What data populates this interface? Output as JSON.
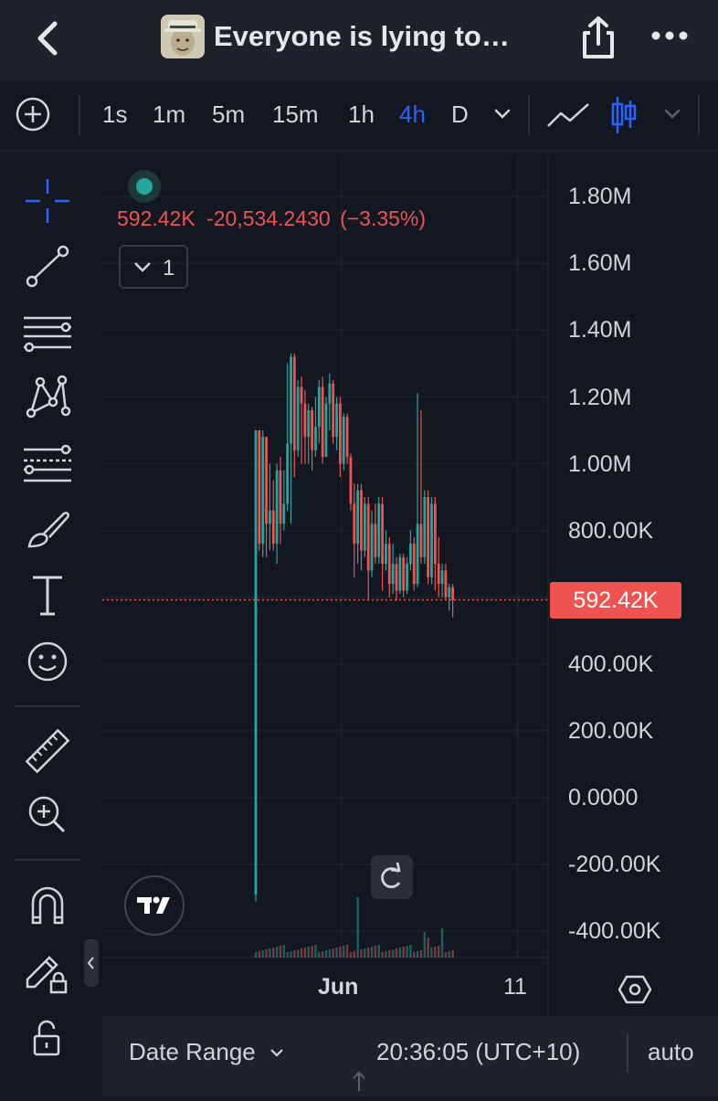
{
  "header": {
    "title": "Everyone is lying to…",
    "back_icon": "chevron-left-icon",
    "share_icon": "share-icon",
    "more_icon": "more-horizontal-icon"
  },
  "toolbar": {
    "intervals": [
      "1s",
      "1m",
      "5m",
      "15m",
      "1h",
      "4h",
      "D"
    ],
    "active_interval": "4h"
  },
  "left_tools": [
    "crosshair-icon",
    "trend-line-icon",
    "horizontal-lines-icon",
    "pattern-icon",
    "fib-icon",
    "brush-icon",
    "text-icon",
    "emoji-icon",
    "ruler-icon",
    "zoom-in-icon",
    "magnet-icon",
    "lock-pencil-icon",
    "unlock-icon"
  ],
  "legend": {
    "price": "592.42K",
    "change": "-20,534.2430",
    "change_pct": "(−3.35%)",
    "collapse_count": "1"
  },
  "y_axis": {
    "labels": [
      "1.80M",
      "1.60M",
      "1.40M",
      "1.20M",
      "1.00M",
      "800.00K",
      "592.42K",
      "400.00K",
      "200.00K",
      "0.0000",
      "-200.00K",
      "-400.00K"
    ],
    "current_price": "592.42K"
  },
  "x_axis": {
    "labels": [
      "Jun",
      "11"
    ]
  },
  "colors": {
    "background": "#131722",
    "up": "#26a69a",
    "down": "#ef5350",
    "accent": "#2962ff"
  },
  "chart_data": {
    "type": "candlestick",
    "x_ticks": [
      "Jun",
      "11"
    ],
    "ylim": [
      -450000,
      1900000
    ],
    "last_price": 592420,
    "change": -20534.243,
    "change_pct": -3.35,
    "candles": [
      [
        -290000,
        1100000,
        -310000,
        1100000
      ],
      [
        1100000,
        760000,
        740000,
        1100000
      ],
      [
        760000,
        1080000,
        720000,
        1100000
      ],
      [
        1080000,
        820000,
        720000,
        1080000
      ],
      [
        820000,
        860000,
        740000,
        1000000
      ],
      [
        860000,
        760000,
        740000,
        950000
      ],
      [
        760000,
        980000,
        700000,
        1000000
      ],
      [
        980000,
        820000,
        760000,
        1020000
      ],
      [
        820000,
        880000,
        800000,
        980000
      ],
      [
        880000,
        1060000,
        860000,
        1300000
      ],
      [
        1060000,
        1320000,
        820000,
        1330000
      ],
      [
        1320000,
        1040000,
        960000,
        1330000
      ],
      [
        1040000,
        1230000,
        1020000,
        1250000
      ],
      [
        1230000,
        1180000,
        1000000,
        1260000
      ],
      [
        1180000,
        1080000,
        1000000,
        1220000
      ],
      [
        1080000,
        1160000,
        1000000,
        1180000
      ],
      [
        1160000,
        1040000,
        980000,
        1170000
      ],
      [
        1040000,
        1110000,
        1020000,
        1200000
      ],
      [
        1110000,
        1230000,
        1060000,
        1250000
      ],
      [
        1230000,
        1020000,
        1000000,
        1260000
      ],
      [
        1020000,
        1180000,
        1020000,
        1200000
      ],
      [
        1180000,
        1240000,
        1100000,
        1270000
      ],
      [
        1240000,
        1080000,
        1060000,
        1250000
      ],
      [
        1080000,
        1180000,
        1040000,
        1200000
      ],
      [
        1180000,
        1000000,
        960000,
        1200000
      ],
      [
        1000000,
        1140000,
        980000,
        1150000
      ],
      [
        1140000,
        1020000,
        1000000,
        1150000
      ],
      [
        1020000,
        880000,
        860000,
        1030000
      ],
      [
        880000,
        760000,
        660000,
        940000
      ],
      [
        760000,
        920000,
        700000,
        940000
      ],
      [
        920000,
        740000,
        680000,
        940000
      ],
      [
        740000,
        880000,
        720000,
        900000
      ],
      [
        880000,
        680000,
        590000,
        900000
      ],
      [
        680000,
        820000,
        660000,
        860000
      ],
      [
        820000,
        720000,
        700000,
        880000
      ],
      [
        720000,
        880000,
        700000,
        900000
      ],
      [
        880000,
        700000,
        620000,
        900000
      ],
      [
        700000,
        760000,
        680000,
        800000
      ],
      [
        760000,
        640000,
        600000,
        780000
      ],
      [
        640000,
        700000,
        610000,
        760000
      ],
      [
        700000,
        620000,
        590000,
        720000
      ],
      [
        620000,
        720000,
        610000,
        730000
      ],
      [
        720000,
        620000,
        600000,
        730000
      ],
      [
        620000,
        700000,
        610000,
        720000
      ],
      [
        700000,
        760000,
        680000,
        800000
      ],
      [
        760000,
        640000,
        620000,
        780000
      ],
      [
        640000,
        820000,
        630000,
        1210000
      ],
      [
        820000,
        720000,
        700000,
        1160000
      ],
      [
        720000,
        900000,
        700000,
        920000
      ],
      [
        900000,
        660000,
        640000,
        920000
      ],
      [
        660000,
        880000,
        640000,
        900000
      ],
      [
        880000,
        700000,
        620000,
        900000
      ],
      [
        700000,
        640000,
        600000,
        780000
      ],
      [
        640000,
        680000,
        600000,
        700000
      ],
      [
        680000,
        600000,
        590000,
        700000
      ],
      [
        600000,
        630000,
        560000,
        640000
      ],
      [
        630000,
        592420,
        540000,
        640000
      ]
    ]
  }
}
